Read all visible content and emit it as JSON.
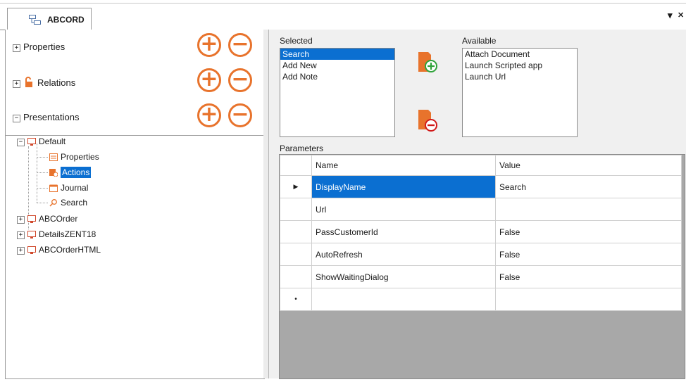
{
  "tab": {
    "title": "ABCORD",
    "pin_glyph": "▾",
    "close_glyph": "✕"
  },
  "sections": [
    {
      "label": "Properties",
      "expand_glyph": "⊞"
    },
    {
      "label": "Relations",
      "expand_glyph": "⊞"
    },
    {
      "label": "Presentations",
      "expand_glyph": "⊟"
    }
  ],
  "add_glyph": "+",
  "remove_glyph": "−",
  "tree": {
    "default_label": "Default",
    "children": [
      "Properties",
      "Actions",
      "Journal",
      "Search"
    ],
    "selected_child": "Actions",
    "others": [
      "ABCOrder",
      "DetailsZENT18",
      "ABCOrderHTML"
    ]
  },
  "selected": {
    "label": "Selected",
    "items": [
      "Search",
      "Add New",
      "Add Note"
    ],
    "selected_item": "Search"
  },
  "available": {
    "label": "Available",
    "items": [
      "Attach Document",
      "Launch Scripted app",
      "Launch Url"
    ]
  },
  "parameters": {
    "label": "Parameters",
    "columns": [
      "Name",
      "Value"
    ],
    "current_row_glyph": "▶",
    "new_row_glyph": "•",
    "rows": [
      {
        "name": "DisplayName",
        "value": "Search"
      },
      {
        "name": "Url",
        "value": ""
      },
      {
        "name": "PassCustomerId",
        "value": "False"
      },
      {
        "name": "AutoRefresh",
        "value": "False"
      },
      {
        "name": "ShowWaitingDialog",
        "value": "False"
      }
    ]
  },
  "colors": {
    "accent": "#e8732c",
    "selection": "#0b6fd1"
  }
}
